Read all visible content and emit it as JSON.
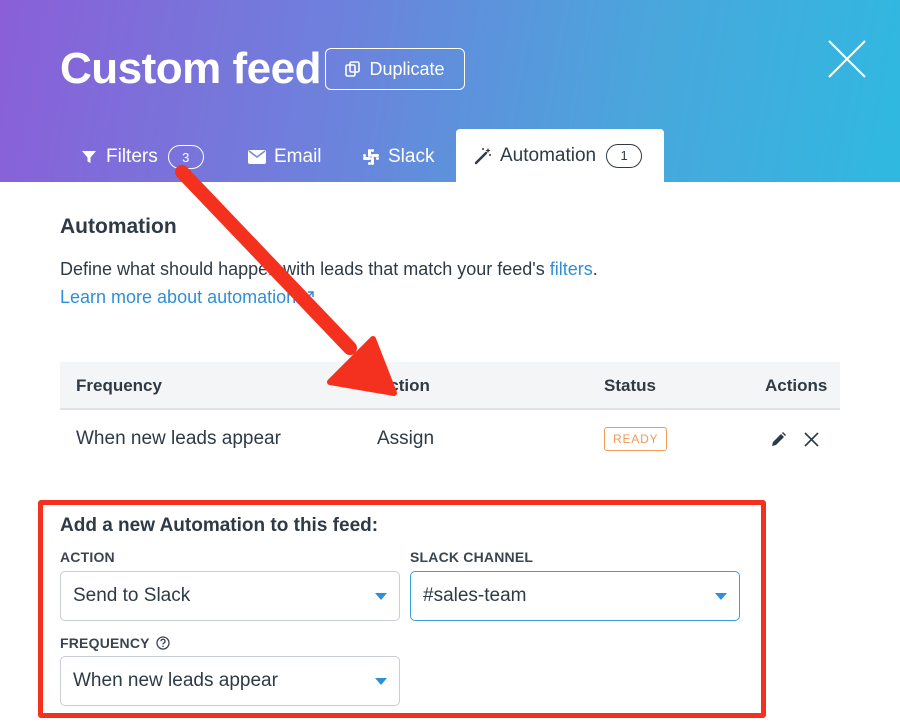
{
  "header": {
    "title": "Custom feed",
    "duplicate_label": "Duplicate",
    "tabs": [
      {
        "label": "Filters",
        "count": "3",
        "icon": "filter-icon"
      },
      {
        "label": "Email",
        "icon": "envelope-icon"
      },
      {
        "label": "Slack",
        "icon": "slack-icon"
      },
      {
        "label": "Automation",
        "count": "1",
        "icon": "magic-wand-icon",
        "active": true
      }
    ]
  },
  "automation": {
    "heading": "Automation",
    "description_prefix": "Define what should happen with leads that match your feed's ",
    "description_link": "filters",
    "description_suffix": ".",
    "learn_more": "Learn more about automation"
  },
  "table": {
    "headers": {
      "frequency": "Frequency",
      "action": "Action",
      "status": "Status",
      "actions": "Actions"
    },
    "rows": [
      {
        "frequency": "When new leads appear",
        "action": "Assign",
        "status": "READY"
      }
    ]
  },
  "add_form": {
    "heading": "Add a new Automation to this feed:",
    "action_label": "ACTION",
    "action_value": "Send to Slack",
    "slack_channel_label": "SLACK CHANNEL",
    "slack_channel_value": "#sales-team",
    "frequency_label": "FREQUENCY",
    "frequency_value": "When new leads appear"
  },
  "colors": {
    "accent_blue": "#2f8fd6",
    "status_ready": "#f29a55",
    "annotation_red": "#f4301f"
  }
}
